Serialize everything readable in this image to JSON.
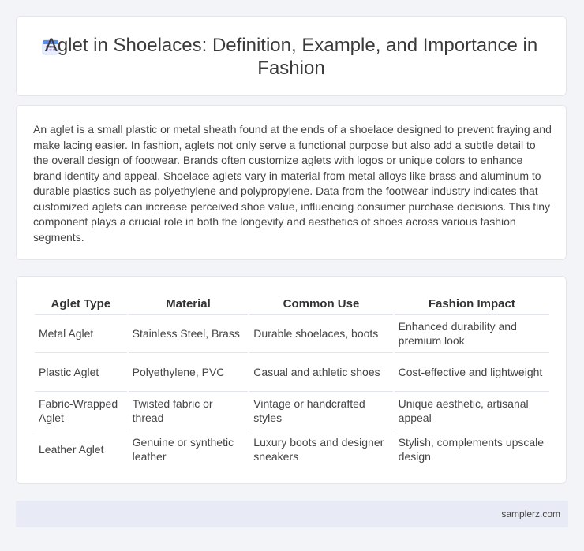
{
  "header": {
    "title": "Aglet in Shoelaces: Definition, Example, and Importance in Fashion",
    "icon": "calendar-icon",
    "icon_color": "#5b8def"
  },
  "description": "An aglet is a small plastic or metal sheath found at the ends of a shoelace designed to prevent fraying and make lacing easier. In fashion, aglets not only serve a functional purpose but also add a subtle detail to the overall design of footwear. Brands often customize aglets with logos or unique colors to enhance brand identity and appeal. Shoelace aglets vary in material from metal alloys like brass and aluminum to durable plastics such as polyethylene and polypropylene. Data from the footwear industry indicates that customized aglets can increase perceived shoe value, influencing consumer purchase decisions. This tiny component plays a crucial role in both the longevity and aesthetics of shoes across various fashion segments.",
  "table": {
    "headers": [
      "Aglet Type",
      "Material",
      "Common Use",
      "Fashion Impact"
    ],
    "rows": [
      [
        "Metal Aglet",
        "Stainless Steel, Brass",
        "Durable shoelaces, boots",
        "Enhanced durability and premium look"
      ],
      [
        "Plastic Aglet",
        "Polyethylene, PVC",
        "Casual and athletic shoes",
        "Cost-effective and lightweight"
      ],
      [
        "Fabric-Wrapped Aglet",
        "Twisted fabric or thread",
        "Vintage or handcrafted styles",
        "Unique aesthetic, artisanal appeal"
      ],
      [
        "Leather Aglet",
        "Genuine or synthetic leather",
        "Luxury boots and designer sneakers",
        "Stylish, complements upscale design"
      ]
    ]
  },
  "footer": {
    "site": "samplerz.com"
  }
}
